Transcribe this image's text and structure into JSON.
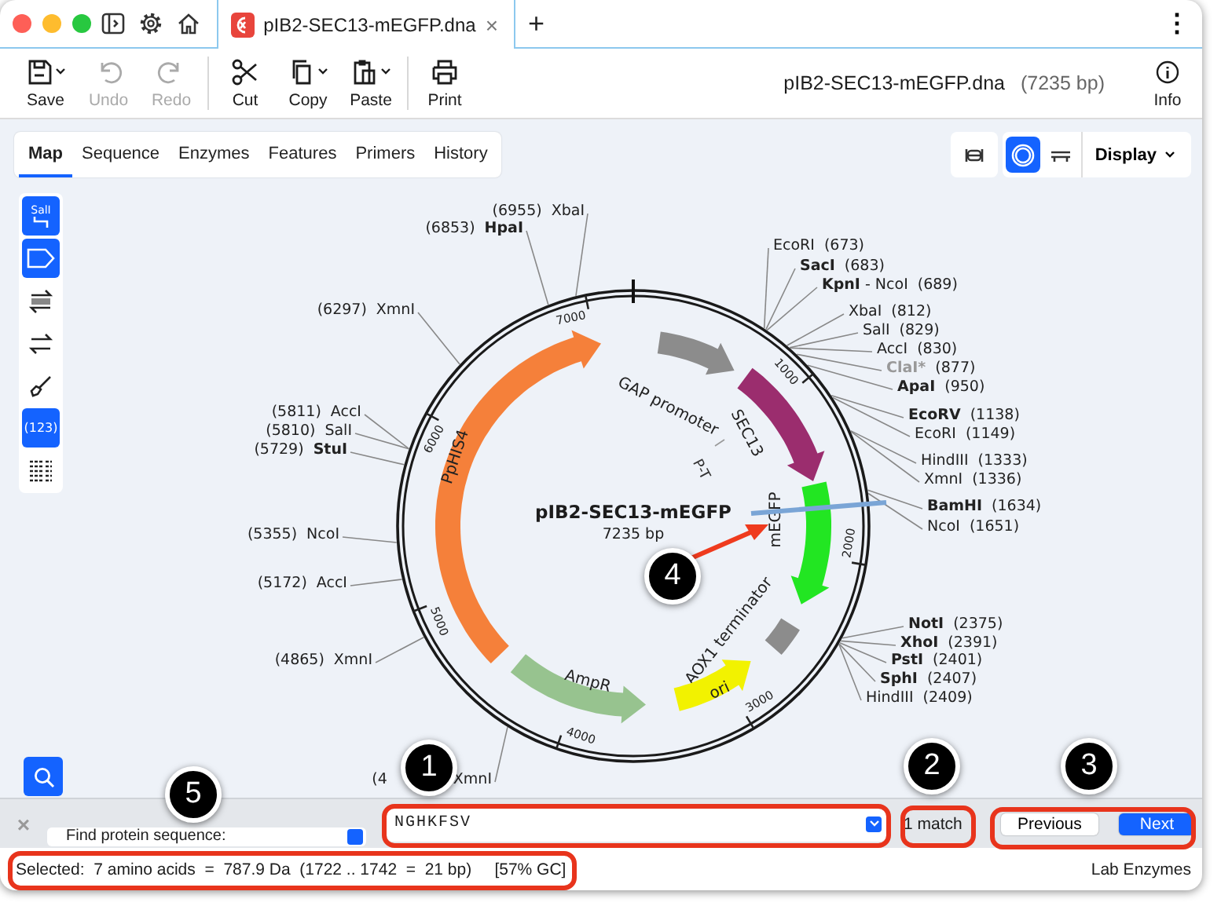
{
  "window": {
    "tab": {
      "title": "pIB2-SEC13-mEGFP.dna",
      "close": "×"
    },
    "new_tab": "+",
    "menu": "⋮"
  },
  "toolbar": {
    "buttons": [
      {
        "label": "Save",
        "kind": "save",
        "disabled": false,
        "menu": true
      },
      {
        "label": "Undo",
        "kind": "undo",
        "disabled": true,
        "menu": false
      },
      {
        "label": "Redo",
        "kind": "redo",
        "disabled": true,
        "menu": false
      },
      {
        "label": "Cut",
        "kind": "cut",
        "disabled": false,
        "menu": false
      },
      {
        "label": "Copy",
        "kind": "copy",
        "disabled": false,
        "menu": true
      },
      {
        "label": "Paste",
        "kind": "paste",
        "disabled": false,
        "menu": true
      },
      {
        "label": "Print",
        "kind": "print",
        "disabled": false,
        "menu": false
      }
    ],
    "file_name": "pIB2-SEC13-mEGFP.dna",
    "file_size": "(7235 bp)",
    "info": "Info"
  },
  "view_tabs": [
    {
      "label": "Map",
      "selected": true
    },
    {
      "label": "Sequence",
      "selected": false
    },
    {
      "label": "Enzymes",
      "selected": false
    },
    {
      "label": "Features",
      "selected": false
    },
    {
      "label": "Primers",
      "selected": false
    },
    {
      "label": "History",
      "selected": false
    }
  ],
  "view_modes": [
    {
      "kind": "linear",
      "selected": false
    },
    {
      "kind": "circular",
      "selected": true
    },
    {
      "kind": "sequence",
      "selected": false
    }
  ],
  "display_menu": "Display",
  "tools": [
    {
      "kind": "enzymes",
      "label": "SalI",
      "selected": true
    },
    {
      "kind": "features",
      "selected": true
    },
    {
      "kind": "strands",
      "selected": false
    },
    {
      "kind": "orfs",
      "selected": false
    },
    {
      "kind": "paint",
      "selected": false
    },
    {
      "kind": "numbers",
      "label": "(123)",
      "selected": true
    },
    {
      "kind": "list",
      "selected": false
    }
  ],
  "map": {
    "name": "pIB2-SEC13-mEGFP",
    "length": "7235 bp",
    "ticks": [
      "1000",
      "2000",
      "3000",
      "4000",
      "5000",
      "6000",
      "7000"
    ],
    "features": [
      {
        "name": "GAP promoter",
        "kind": "promoter",
        "color": "#8c8c8c"
      },
      {
        "name": "SEC13",
        "kind": "gene",
        "color": "#9b2d6e"
      },
      {
        "name": "mEGFP",
        "kind": "gene",
        "color": "#22e622"
      },
      {
        "name": "AOX1 terminator",
        "kind": "terminator",
        "color": "#8c8c8c"
      },
      {
        "name": "ori",
        "kind": "origin",
        "color": "#f2f200"
      },
      {
        "name": "AmpR",
        "kind": "gene",
        "color": "#97c38f"
      },
      {
        "name": "PpHIS4",
        "kind": "gene",
        "color": "#f5803a"
      }
    ],
    "primer": "P-T",
    "sites": [
      {
        "position": "(6955)",
        "name": "XbaI",
        "kind": "normal"
      },
      {
        "position": "(6853)",
        "name": "HpaI",
        "kind": "unique"
      },
      {
        "position": "(6297)",
        "name": "XmnI",
        "kind": "normal"
      },
      {
        "position": "(5811)",
        "name": "AccI",
        "kind": "normal"
      },
      {
        "position": "(5810)",
        "name": "SalI",
        "kind": "normal"
      },
      {
        "position": "(5729)",
        "name": "StuI",
        "kind": "unique"
      },
      {
        "position": "(5355)",
        "name": "NcoI",
        "kind": "normal"
      },
      {
        "position": "(5172)",
        "name": "AccI",
        "kind": "normal"
      },
      {
        "position": "(4865)",
        "name": "XmnI",
        "kind": "normal"
      },
      {
        "position": "(4",
        "name": "XmnI",
        "kind": "normal"
      },
      {
        "position": "(673)",
        "name": "EcoRI",
        "kind": "normal"
      },
      {
        "position": "(683)",
        "name": "SacI",
        "kind": "unique"
      },
      {
        "position": "(689)",
        "name": "**KpnI** - NcoI",
        "kind": "normal"
      },
      {
        "position": "(812)",
        "name": "XbaI",
        "kind": "normal"
      },
      {
        "position": "(829)",
        "name": "SalI",
        "kind": "normal"
      },
      {
        "position": "(830)",
        "name": "AccI",
        "kind": "normal"
      },
      {
        "position": "(877)",
        "name": "ClaI*",
        "kind": "blocked"
      },
      {
        "position": "(950)",
        "name": "ApaI",
        "kind": "unique"
      },
      {
        "position": "(1138)",
        "name": "EcoRV",
        "kind": "unique"
      },
      {
        "position": "(1149)",
        "name": "EcoRI",
        "kind": "normal"
      },
      {
        "position": "(1333)",
        "name": "HindIII",
        "kind": "normal"
      },
      {
        "position": "(1336)",
        "name": "XmnI",
        "kind": "normal"
      },
      {
        "position": "(1634)",
        "name": "BamHI",
        "kind": "unique"
      },
      {
        "position": "(1651)",
        "name": "NcoI",
        "kind": "normal"
      },
      {
        "position": "(2375)",
        "name": "NotI",
        "kind": "unique"
      },
      {
        "position": "(2391)",
        "name": "XhoI",
        "kind": "unique"
      },
      {
        "position": "(2401)",
        "name": "PstI",
        "kind": "unique"
      },
      {
        "position": "(2407)",
        "name": "SphI",
        "kind": "unique"
      },
      {
        "position": "(2409)",
        "name": "HindIII",
        "kind": "normal"
      }
    ]
  },
  "callouts": [
    "1",
    "2",
    "3",
    "4",
    "5"
  ],
  "find_bar": {
    "close": "×",
    "mode": "Find protein sequence:",
    "query": "NGHKFSV",
    "matches": "1 match",
    "buttons": [
      {
        "label": "Previous",
        "selected": false
      },
      {
        "label": "Next",
        "selected": true
      }
    ]
  },
  "status_bar": {
    "selection": "Selected:  7 amino acids  =  787.9 Da  (1722 .. 1742  =  21 bp)     [57% GC]",
    "enzymes": "Lab Enzymes"
  }
}
